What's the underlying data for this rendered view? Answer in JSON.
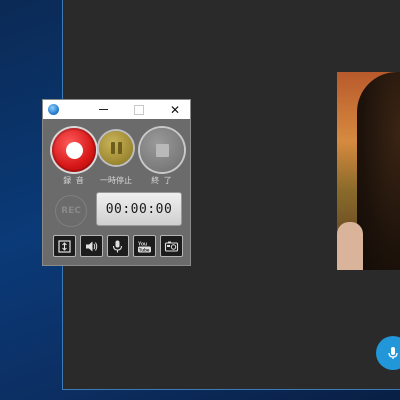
{
  "recorder": {
    "title_bar": {
      "minimize_symbol": "—",
      "maximize_symbol": "☐",
      "close_symbol": "✕"
    },
    "buttons": {
      "record_label": "録 音",
      "pause_label": "一時停止",
      "stop_label": "終 了"
    },
    "rec_indicator": "REC",
    "timer": "00:00:00",
    "toolbar": [
      {
        "icon": "fit-window-icon"
      },
      {
        "icon": "speaker-icon"
      },
      {
        "icon": "microphone-icon"
      },
      {
        "icon": "youtube-icon"
      },
      {
        "icon": "camera-icon"
      }
    ]
  },
  "colors": {
    "record_red": "#d61616",
    "pause_gold": "#9c8731",
    "stop_gray": "#7a7a7a",
    "mic_fab_blue": "#2196d8"
  }
}
